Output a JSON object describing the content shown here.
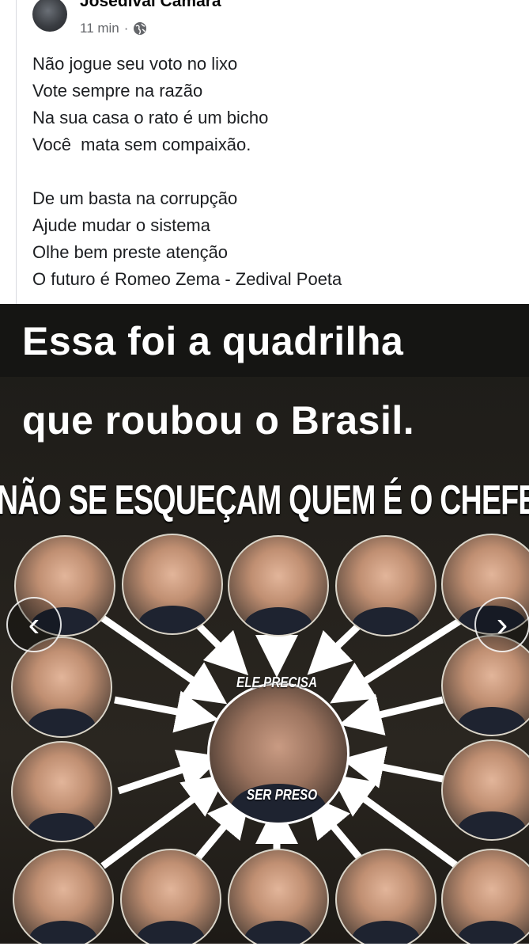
{
  "post": {
    "author": "Josedival Camara",
    "time": "11 min",
    "separator": "·",
    "privacy_icon": "globe-icon",
    "lines_stanza_1": [
      "Não jogue seu voto no lixo",
      "Vote sempre na razão",
      "Na sua casa o rato é um bicho",
      "Você  mata sem compaixão."
    ],
    "lines_stanza_2": [
      "De um basta na corrupção",
      "Ajude mudar o sistema",
      "Olhe bem preste atenção",
      "O futuro é Romeo Zema - Zedival Poeta"
    ]
  },
  "photo": {
    "headline_line_1": "Essa foi a quadrilha",
    "headline_line_2": "que roubou o Brasil.",
    "banner": "NÃO SE ESQUEÇAM QUEM É O CHEFE",
    "center_label_top": "ELE PRECISA",
    "center_label_bottom": "SER PRESO",
    "prev_icon": "chevron-left-icon",
    "next_icon": "chevron-right-icon",
    "prev_glyph": "‹",
    "next_glyph": "›"
  },
  "colors": {
    "author_text": "#050505",
    "meta_text": "#65676b",
    "body_text": "#1c1e21",
    "photo_background": "#24211c",
    "arrow": "#ffffff"
  }
}
